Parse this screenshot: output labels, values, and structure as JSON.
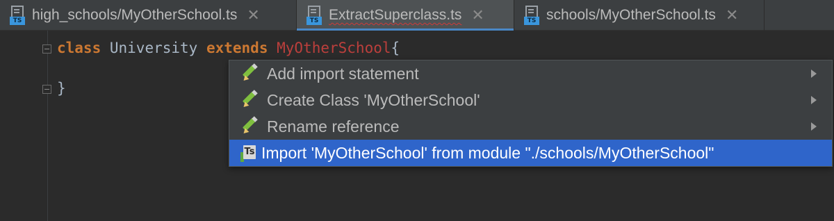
{
  "tabs": [
    {
      "label": "high_schools/MyOtherSchool.ts",
      "icon": "typescript-file-icon",
      "active": false,
      "close": "✕"
    },
    {
      "label": "ExtractSuperclass.ts",
      "icon": "typescript-file-icon",
      "active": true,
      "close": "✕"
    },
    {
      "label": "schools/MyOtherSchool.ts",
      "icon": "typescript-file-icon",
      "active": false,
      "close": "✕"
    }
  ],
  "file_icon_badge": "TS",
  "code": {
    "line1": {
      "keyword_class": "class",
      "class_name": "University",
      "keyword_extends": "extends",
      "superclass": "MyOtherSchool",
      "open_brace": "{"
    },
    "line2": {
      "close_brace": "}"
    }
  },
  "intention_popup": {
    "items": [
      {
        "label": "Add import statement",
        "icon": "pencil-icon",
        "has_submenu": true,
        "selected": false
      },
      {
        "label": "Create Class 'MyOtherSchool'",
        "icon": "pencil-icon",
        "has_submenu": true,
        "selected": false
      },
      {
        "label": "Rename reference",
        "icon": "pencil-icon",
        "has_submenu": true,
        "selected": false
      },
      {
        "label": "Import 'MyOtherSchool' from module \"./schools/MyOtherSchool\"",
        "icon": "typescript-import-icon",
        "has_submenu": false,
        "selected": true
      }
    ],
    "import_icon_text": "Ts"
  },
  "colors": {
    "editor_bg": "#2b2b2b",
    "tab_bar_bg": "#3c3f41",
    "active_tab_underline": "#4a88c7",
    "keyword": "#cc7832",
    "unresolved_reference": "#bc3f3c",
    "selection": "#2f65ca"
  }
}
